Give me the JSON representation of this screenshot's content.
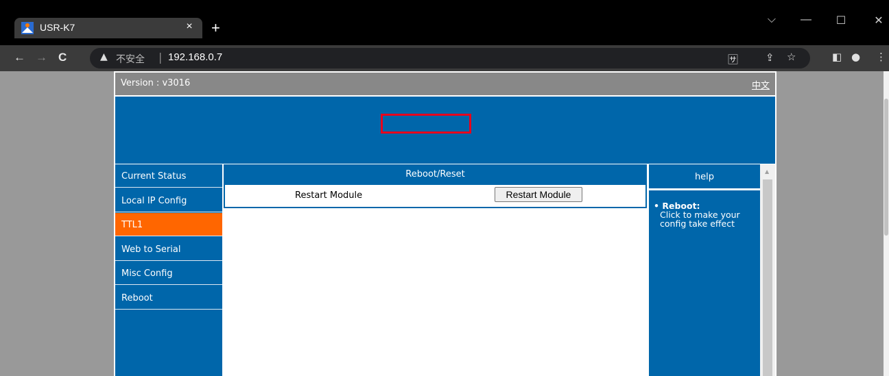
{
  "browser": {
    "tab_title": "USR-K7",
    "tab_close": "×",
    "new_tab": "+",
    "window_controls": {
      "dropdown": "⌵",
      "minimize": "—",
      "maximize": "☐",
      "close": "✕"
    },
    "nav": {
      "back": "←",
      "forward": "→",
      "reload": "C"
    },
    "security_icon": "▲",
    "security_label": "不安全",
    "separator": "|",
    "url": "192.168.0.7",
    "toolbar_icons": [
      "translate-icon",
      "share-icon",
      "star-icon",
      "sidepanel-icon",
      "profile-icon",
      "menu-icon"
    ]
  },
  "header": {
    "version": "Version : v3016",
    "language_link": "中文"
  },
  "sidebar": {
    "items": [
      {
        "label": "Current Status",
        "active": false
      },
      {
        "label": "Local IP Config",
        "active": false
      },
      {
        "label": "TTL1",
        "active": true
      },
      {
        "label": "Web to Serial",
        "active": false
      },
      {
        "label": "Misc Config",
        "active": false
      },
      {
        "label": "Reboot",
        "active": false
      }
    ]
  },
  "main": {
    "section_title": "Reboot/Reset",
    "row_label": "Restart Module",
    "button_label": "Restart Module"
  },
  "help": {
    "title": "help",
    "bullet": "•",
    "term": "Reboot:",
    "text": "Click to make your config take effect"
  },
  "colors": {
    "brand_blue": "#0066aa",
    "active_orange": "#ff6600",
    "highlight_red": "#e8001c"
  }
}
